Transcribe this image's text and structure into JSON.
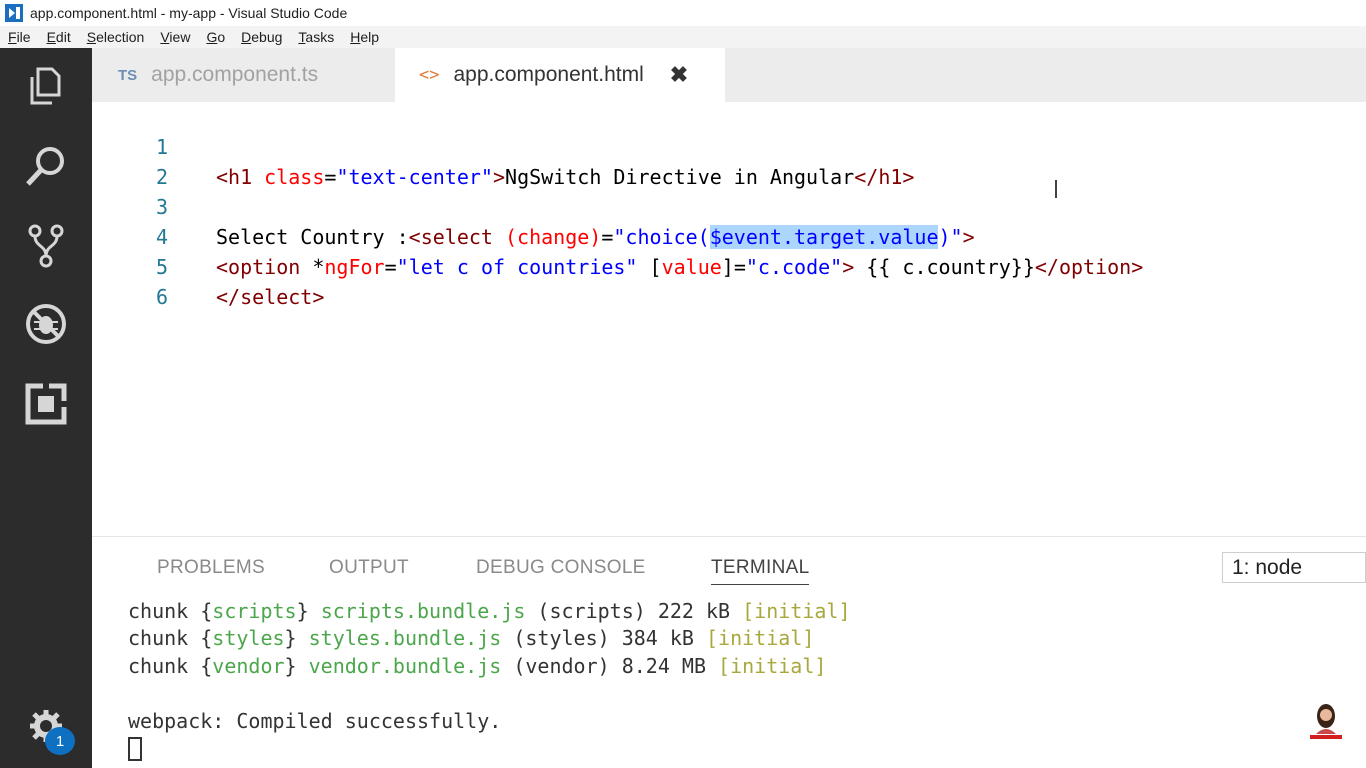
{
  "window": {
    "title": "app.component.html - my-app - Visual Studio Code"
  },
  "menu": [
    {
      "label": "File",
      "mnemonic": "F",
      "rest": "ile"
    },
    {
      "label": "Edit",
      "mnemonic": "E",
      "rest": "dit"
    },
    {
      "label": "Selection",
      "mnemonic": "S",
      "rest": "election"
    },
    {
      "label": "View",
      "mnemonic": "V",
      "rest": "iew"
    },
    {
      "label": "Go",
      "mnemonic": "G",
      "rest": "o"
    },
    {
      "label": "Debug",
      "mnemonic": "D",
      "rest": "ebug"
    },
    {
      "label": "Tasks",
      "mnemonic": "T",
      "rest": "asks"
    },
    {
      "label": "Help",
      "mnemonic": "H",
      "rest": "elp"
    }
  ],
  "activity_bar": {
    "icons": [
      "explorer-icon",
      "search-icon",
      "source-control-icon",
      "debug-icon",
      "extensions-icon",
      "settings-gear-icon"
    ],
    "settings_badge": "1"
  },
  "tabs": [
    {
      "badge": "TS",
      "label": "app.component.ts",
      "active": false
    },
    {
      "badge": "<>",
      "label": "app.component.html",
      "active": true,
      "close": "✖"
    }
  ],
  "editor": {
    "lines": [
      {
        "n": "1"
      },
      {
        "n": "2"
      },
      {
        "n": "3"
      },
      {
        "n": "4"
      },
      {
        "n": "5"
      },
      {
        "n": "6"
      }
    ],
    "l1": {
      "open": "<h1",
      "attr": "class",
      "eq": "=",
      "val": "\"text-center\"",
      "close": ">",
      "text": "NgSwitch Directive in Angular",
      "end": "</h1>"
    },
    "l3": {
      "text": "Select Country :",
      "open": "<select",
      "attr": "(change)",
      "eq": "=",
      "val_a": "\"choice(",
      "val_sel": "$event.target.value",
      "val_b": ")\"",
      "close": ">"
    },
    "l4": {
      "open": "<option",
      "star": "*",
      "attr": "ngFor",
      "eq": "=",
      "val": "\"let c of countries\"",
      "br_open": "[",
      "attr2": "value",
      "br_close": "]",
      "eq2": "=",
      "val2": "\"c.code\"",
      "close": ">",
      "text": " {{ c.country}}",
      "end": "</option>"
    },
    "l5": {
      "end": "</select>"
    }
  },
  "panel": {
    "tabs": [
      "PROBLEMS",
      "OUTPUT",
      "DEBUG CONSOLE",
      "TERMINAL"
    ],
    "active_tab": "TERMINAL",
    "terminal_selector": "1: node",
    "terminal": {
      "l1": {
        "a": "chunk {",
        "name": "scripts",
        "b": "} ",
        "file": "scripts.bundle.js",
        "c": " (scripts) 222 kB ",
        "tag": "[initial]"
      },
      "l2": {
        "a": "chunk {",
        "name": "styles",
        "b": "} ",
        "file": "styles.bundle.js",
        "c": " (styles) 384 kB ",
        "tag": "[initial]"
      },
      "l3": {
        "a": "chunk {",
        "name": "vendor",
        "b": "} ",
        "file": "vendor.bundle.js",
        "c": " (vendor) 8.24 MB ",
        "tag": "[initial]"
      },
      "l4": "webpack: Compiled successfully."
    }
  },
  "colors": {
    "activity_bar": "#2c2c2c",
    "tag": "#800000",
    "attribute": "#ff0000",
    "string": "#0000ff",
    "selection": "#add6ff",
    "terminal_green": "#4ca64c",
    "terminal_yellow": "#a8a83c"
  }
}
